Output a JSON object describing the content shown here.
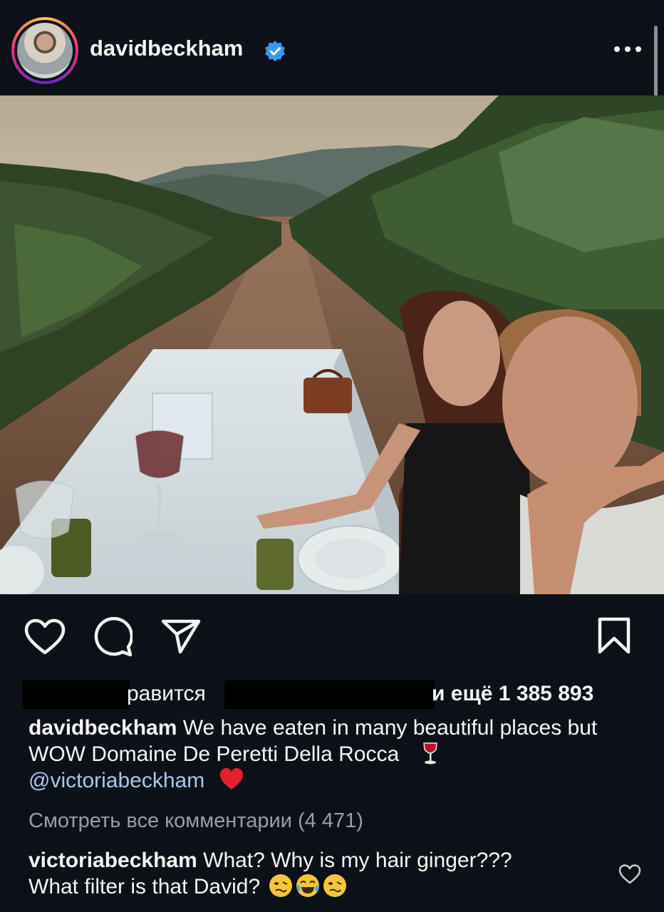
{
  "post": {
    "username": "davidbeckham",
    "verified": true,
    "more_icon": "more-horizontal-icon"
  },
  "actions": {
    "like_icon": "heart-outline-icon",
    "comment_icon": "comment-bubble-icon",
    "share_icon": "send-paper-plane-icon",
    "save_icon": "bookmark-outline-icon"
  },
  "likes": {
    "partial_text": "равится",
    "and_more": "и ещё 1 385 893"
  },
  "caption": {
    "username": "davidbeckham",
    "text": "We have eaten in many beautiful places but WOW Domaine De Peretti Della Rocca",
    "emoji_1": "wine-glass-emoji",
    "mention": "@victoriabeckham",
    "emoji_2": "red-heart-emoji"
  },
  "view_comments": "Смотреть все комментарии (4 471)",
  "top_comment": {
    "username": "victoriabeckham",
    "text_line1": "What? Why is my hair ginger???",
    "text_line2": "What filter is that David?",
    "emojis": [
      "woozy-face-emoji",
      "crying-laughing-emoji",
      "woozy-face-emoji"
    ],
    "like_icon": "heart-small-icon"
  },
  "colors": {
    "background": "#0c1117",
    "text": "#f5f5f5",
    "mention": "#a9c6ef",
    "muted": "#9b9fa5",
    "verified": "#3897f0"
  }
}
